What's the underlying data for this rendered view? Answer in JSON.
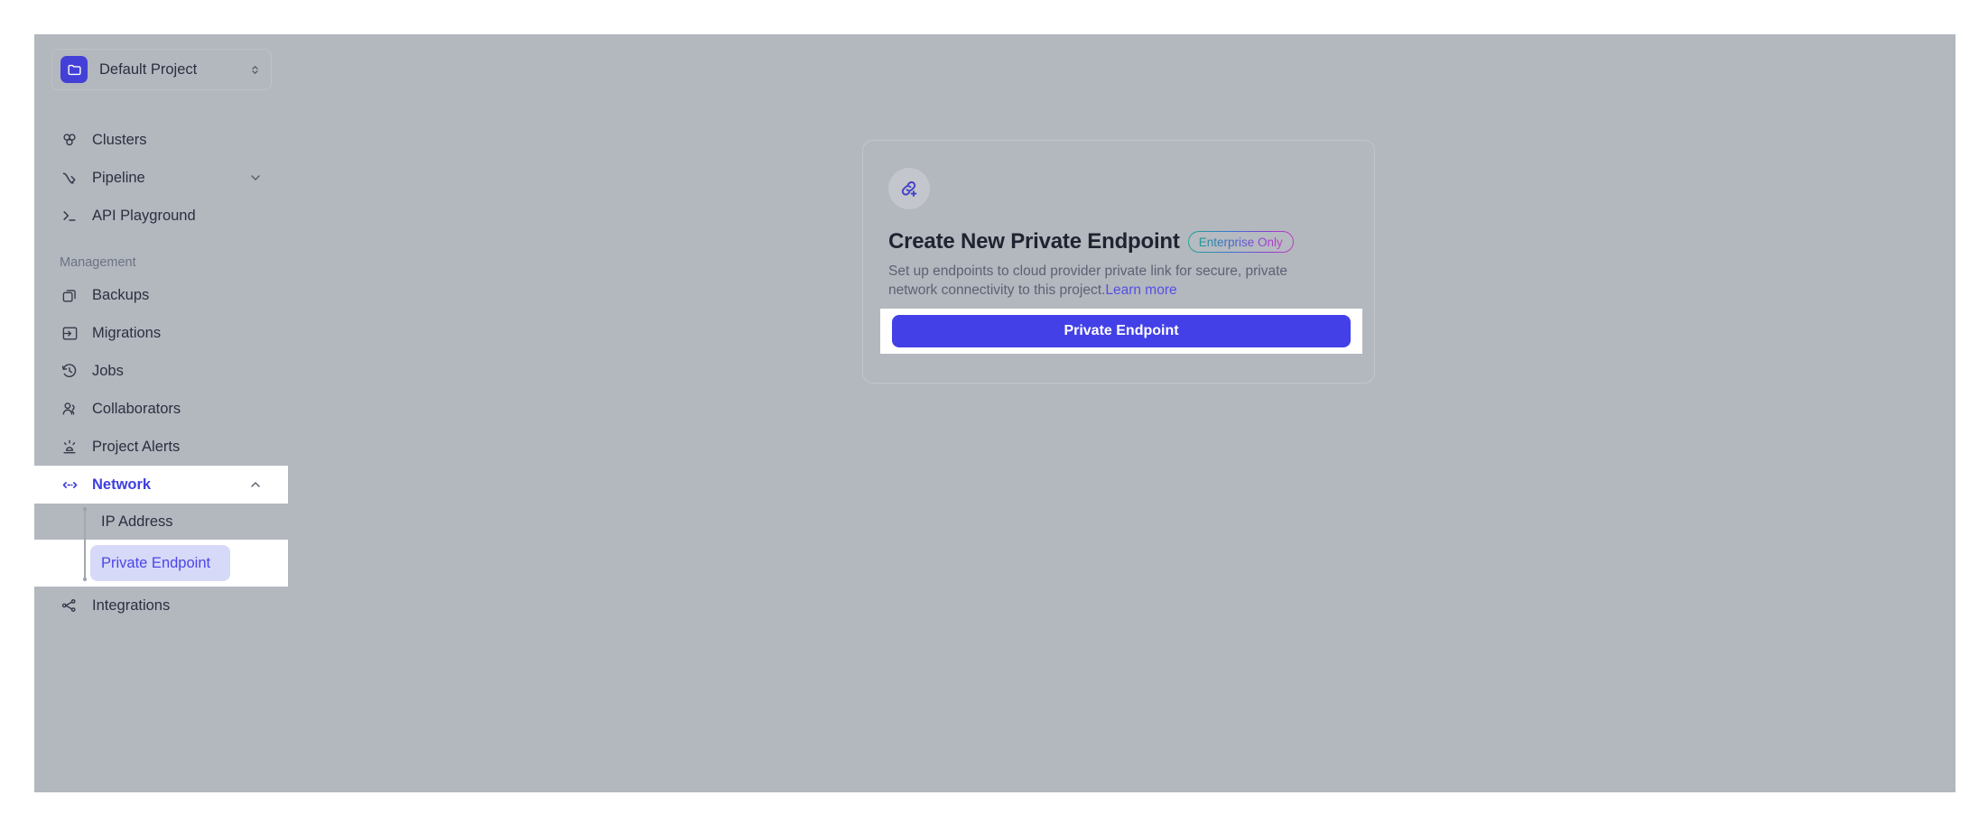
{
  "project_selector": {
    "name": "Default Project",
    "icon": "folder-icon",
    "chevron_icon": "chevron-up-down-icon"
  },
  "sidebar": {
    "primary_items": [
      {
        "label": "Clusters",
        "icon": "clusters-icon",
        "expandable": false
      },
      {
        "label": "Pipeline",
        "icon": "pipeline-icon",
        "expandable": true,
        "chevron": "chevron-down-icon"
      },
      {
        "label": "API Playground",
        "icon": "terminal-icon",
        "expandable": false
      }
    ],
    "section_label": "Management",
    "management_items": [
      {
        "label": "Backups",
        "icon": "backups-icon"
      },
      {
        "label": "Migrations",
        "icon": "migrations-icon"
      },
      {
        "label": "Jobs",
        "icon": "jobs-clock-icon"
      },
      {
        "label": "Collaborators",
        "icon": "collaborators-icon"
      },
      {
        "label": "Project Alerts",
        "icon": "alert-beacon-icon"
      }
    ],
    "network": {
      "label": "Network",
      "icon": "network-arrows-icon",
      "chevron": "chevron-up-icon",
      "expanded": true,
      "active": true,
      "children": [
        {
          "label": "IP Address",
          "selected": false
        },
        {
          "label": "Private Endpoint",
          "selected": true
        }
      ]
    },
    "integrations": {
      "label": "Integrations",
      "icon": "integrations-share-icon"
    }
  },
  "card": {
    "icon": "link-plus-icon",
    "title": "Create New Private Endpoint",
    "badge": "Enterprise Only",
    "description": "Set up endpoints to cloud provider private link for secure, private network connectivity to this project.",
    "learn_more": "Learn more",
    "cta_label": "Private Endpoint"
  },
  "colors": {
    "accent": "#4340e8",
    "accent_text": "#4a46e8",
    "app_background": "#b3b7be",
    "selected_item_background": "#d7d9f8",
    "badge_gradient_start": "#1fa88f",
    "badge_gradient_end": "#c43fc2",
    "link": "#5450e4"
  }
}
